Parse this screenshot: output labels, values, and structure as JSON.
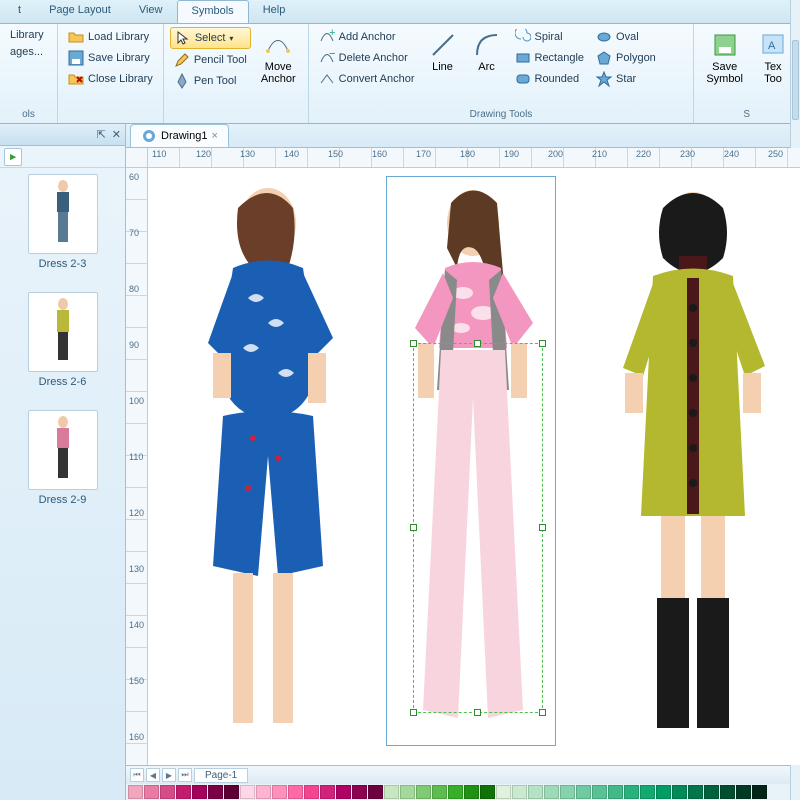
{
  "tabs": {
    "t1": "t",
    "t2": "Page Layout",
    "t3": "View",
    "t4": "Symbols",
    "t5": "Help"
  },
  "ribbon": {
    "library": {
      "load": "Load Library",
      "save": "Save Library",
      "close": "Close Library",
      "lib1": "Library",
      "lib2": "ages...",
      "group": "ols"
    },
    "tools": {
      "select": "Select",
      "pencil": "Pencil Tool",
      "pen": "Pen Tool",
      "move": "Move\nAnchor"
    },
    "anchor": {
      "add": "Add Anchor",
      "del": "Delete Anchor",
      "conv": "Convert Anchor"
    },
    "line": "Line",
    "arc": "Arc",
    "shapes": {
      "spiral": "Spiral",
      "rect": "Rectangle",
      "round": "Rounded",
      "oval": "Oval",
      "poly": "Polygon",
      "star": "Star"
    },
    "drawgroup": "Drawing Tools",
    "savesym": "Save\nSymbol",
    "texttool": "Tex\nToo",
    "sgroup": "S"
  },
  "side": {
    "pin": "⇱",
    "close": "✕",
    "items": [
      {
        "label": "Dress 2-3"
      },
      {
        "label": "Dress 2-6"
      },
      {
        "label": "Dress 2-9"
      }
    ]
  },
  "doc": {
    "title": "Drawing1"
  },
  "rulertop": [
    "110",
    "120",
    "130",
    "140",
    "150",
    "160",
    "170",
    "180",
    "190",
    "200",
    "210",
    "220",
    "230",
    "240",
    "250"
  ],
  "rulerleft": [
    "60",
    "70",
    "80",
    "90",
    "100",
    "110",
    "120",
    "130",
    "140",
    "150",
    "160"
  ],
  "page": {
    "label": "Page-1"
  },
  "colors": [
    "#f2a6bd",
    "#e87aa3",
    "#d84b89",
    "#c31c6f",
    "#a4005c",
    "#7d0046",
    "#5f0035",
    "#ffd6e7",
    "#ffb3d1",
    "#ff8fbc",
    "#ff6aa6",
    "#f54591",
    "#d2217b",
    "#b00066",
    "#8e0052",
    "#6d003f",
    "#c7e7c1",
    "#a3d99a",
    "#7fcb74",
    "#5cbd4e",
    "#38af28",
    "#1f9113",
    "#0f7308",
    "#e0f2dc",
    "#caead0",
    "#b3e2c4",
    "#9cdab8",
    "#85d2ac",
    "#6ecaa0",
    "#57c294",
    "#41ba88",
    "#2ab27c",
    "#13aa70",
    "#009e64",
    "#008a57",
    "#00764a",
    "#00623d",
    "#004e30",
    "#003a24",
    "#002617"
  ]
}
